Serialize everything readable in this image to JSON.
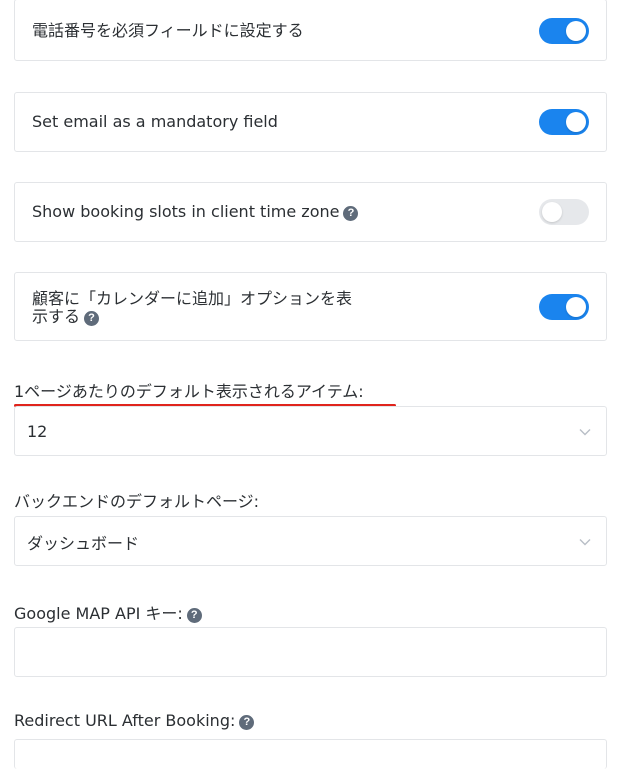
{
  "settings": {
    "phone_mandatory": {
      "label": "電話番号を必須フィールドに設定する",
      "enabled": true
    },
    "email_mandatory": {
      "label": "Set email as a mandatory field",
      "enabled": true
    },
    "client_timezone": {
      "label": "Show booking slots in client time zone",
      "enabled": false
    },
    "add_to_calendar": {
      "label_line1": "顧客に「カレンダーに追加」オプションを表",
      "label_line2": "示する",
      "enabled": true
    }
  },
  "items_per_page": {
    "label": "1ページあたりのデフォルト表示されるアイテム:",
    "value": "12"
  },
  "backend_default_page": {
    "label": "バックエンドのデフォルトページ:",
    "value": "ダッシュボード"
  },
  "google_map_api_key": {
    "label": "Google MAP API キー:",
    "value": ""
  },
  "redirect_url": {
    "label": "Redirect URL After Booking:",
    "value": ""
  },
  "help_glyph": "?",
  "colors": {
    "toggle_on": "#1a84ee",
    "toggle_off": "#e6e8eb",
    "annotation": "#e0241c"
  }
}
